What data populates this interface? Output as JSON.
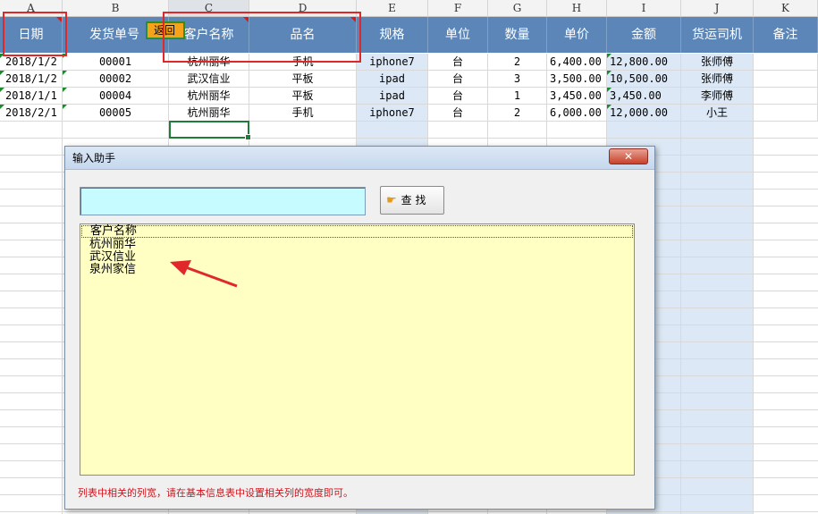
{
  "columns": [
    "A",
    "B",
    "C",
    "D",
    "E",
    "F",
    "G",
    "H",
    "I",
    "J",
    "K"
  ],
  "headers": [
    "日期",
    "发货单号",
    "客户名称",
    "品名",
    "规格",
    "单位",
    "数量",
    "单价",
    "金额",
    "货运司机",
    "备注"
  ],
  "rows": [
    [
      "2018/1/2",
      "00001",
      "杭州丽华",
      "手机",
      "iphone7",
      "台",
      "2",
      "6,400.00",
      "12,800.00",
      "张师傅",
      ""
    ],
    [
      "2018/1/2",
      "00002",
      "武汉信业",
      "平板",
      "ipad",
      "台",
      "3",
      "3,500.00",
      "10,500.00",
      "张师傅",
      ""
    ],
    [
      "2018/1/1",
      "00004",
      "杭州丽华",
      "平板",
      "ipad",
      "台",
      "1",
      "3,450.00",
      "3,450.00",
      "李师傅",
      ""
    ],
    [
      "2018/2/1",
      "00005",
      "杭州丽华",
      "手机",
      "iphone7",
      "台",
      "2",
      "6,000.00",
      "12,000.00",
      "小王",
      ""
    ]
  ],
  "return_button": "返回",
  "dialog": {
    "title": "输入助手",
    "close_label": "✕",
    "search_value": "",
    "search_button": "查  找",
    "list": [
      "客户名称",
      "杭州丽华",
      "武汉信业",
      "泉州家信"
    ],
    "footer_note": "列表中相关的列宽，请在基本信息表中设置相关列的宽度即可。"
  },
  "colors": {
    "header_bg": "#5b86b7",
    "highlight_col": "#dce8f5",
    "annotation_red": "#e0282a",
    "list_bg": "#ffffc4",
    "search_bg": "#c6fbff"
  }
}
